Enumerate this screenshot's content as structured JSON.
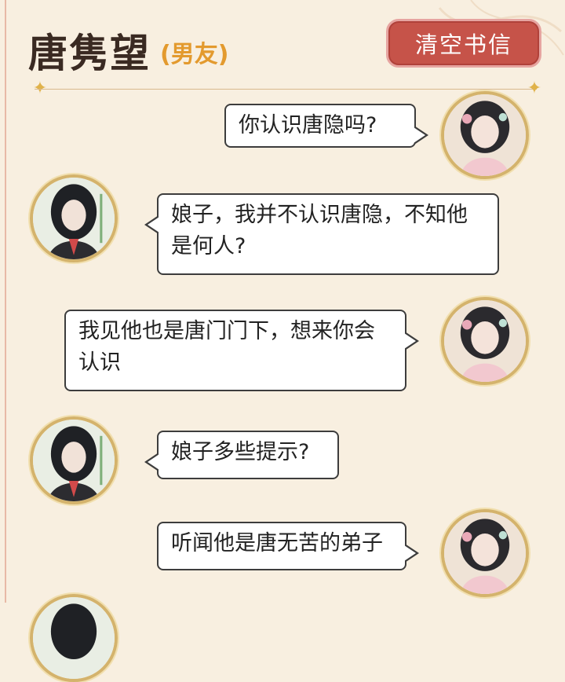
{
  "header": {
    "contact_name": "唐隽望",
    "contact_role": "(男友)",
    "clear_button_label": "清空书信"
  },
  "messages": [
    {
      "sender": "player",
      "text": "你认识唐隐吗?"
    },
    {
      "sender": "contact",
      "text_line1": "娘子，我并不认识唐隐，不知他",
      "text_line2": "是何人?"
    },
    {
      "sender": "player",
      "text_line1": "我见他也是唐门门下，想来你会",
      "text_line2": "认识"
    },
    {
      "sender": "contact",
      "text": "娘子多些提示?"
    },
    {
      "sender": "player",
      "text": "听闻他是唐无苦的弟子"
    }
  ],
  "colors": {
    "background": "#f8efe0",
    "button": "#c65349",
    "role_text": "#e39a2e",
    "avatar_ring": "#d4b36c"
  }
}
